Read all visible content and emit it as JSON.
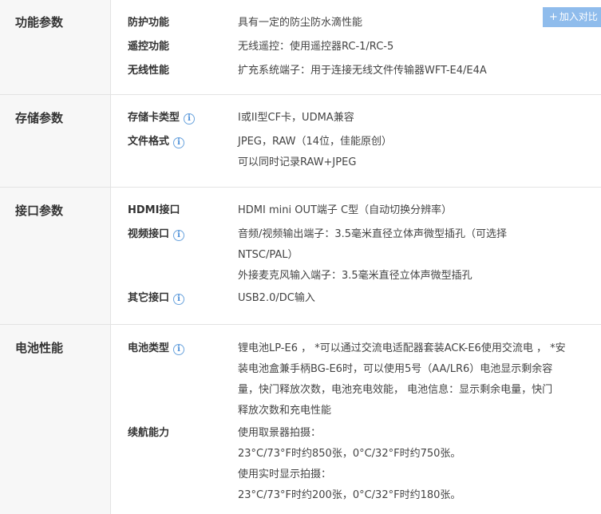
{
  "compare_button": {
    "icon": "plus-icon",
    "label": "加入对比"
  },
  "sections": [
    {
      "title": "功能参数",
      "rows": [
        {
          "label": "防护功能",
          "info": false,
          "values": [
            "具有一定的防尘防水滴性能"
          ]
        },
        {
          "label": "遥控功能",
          "info": false,
          "values": [
            "无线遥控：使用遥控器RC-1/RC-5"
          ]
        },
        {
          "label": "无线性能",
          "info": false,
          "values": [
            "扩充系统端子：用于连接无线文件传输器WFT-E4/E4A"
          ]
        }
      ]
    },
    {
      "title": "存储参数",
      "rows": [
        {
          "label": "存储卡类型",
          "info": true,
          "values": [
            "I或II型CF卡，UDMA兼容"
          ]
        },
        {
          "label": "文件格式",
          "info": true,
          "values": [
            "JPEG，RAW（14位，佳能原创）",
            "可以同时记录RAW+JPEG"
          ]
        }
      ]
    },
    {
      "title": "接口参数",
      "rows": [
        {
          "label": "HDMI接口",
          "info": false,
          "values": [
            "HDMI mini OUT端子 C型（自动切换分辨率）"
          ]
        },
        {
          "label": "视频接口",
          "info": true,
          "values": [
            "音频/视频输出端子：3.5毫米直径立体声微型插孔（可选择",
            "NTSC/PAL）",
            "外接麦克风输入端子：3.5毫米直径立体声微型插孔"
          ]
        },
        {
          "label": "其它接口",
          "info": true,
          "values": [
            "USB2.0/DC输入"
          ]
        }
      ]
    },
    {
      "title": "电池性能",
      "rows": [
        {
          "label": "电池类型",
          "info": true,
          "values": [
            "锂电池LP-E6 ，  *可以通过交流电适配器套装ACK-E6使用交流电 ， *安",
            "装电池盒兼手柄BG-E6时，可以使用5号（AA/LR6）电池显示剩余容",
            "量，快门释放次数，电池充电效能， 电池信息：显示剩余电量，快门",
            "释放次数和充电性能"
          ]
        },
        {
          "label": "续航能力",
          "info": false,
          "values": [
            "使用取景器拍摄：",
            "23°C/73°F时约850张，0°C/32°F时约750张。",
            "使用实时显示拍摄：",
            "23°C/73°F时约200张，0°C/32°F时约180张。"
          ]
        }
      ]
    }
  ],
  "info_icon_glyph": "i"
}
